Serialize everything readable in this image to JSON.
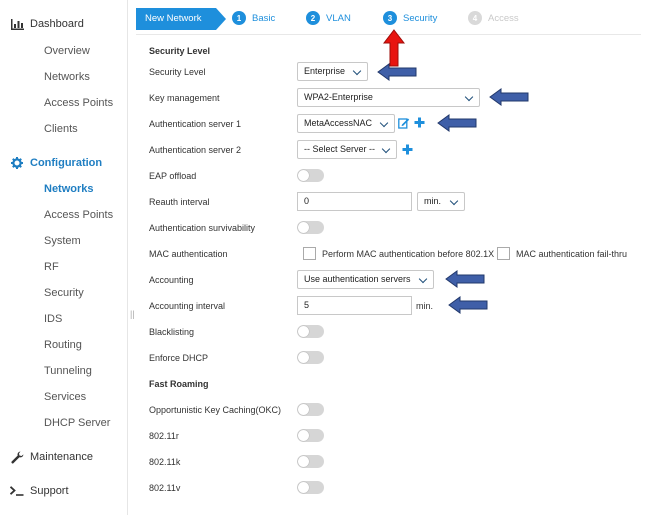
{
  "sidebar": {
    "dashboard": {
      "label": "Dashboard",
      "icon": "bar-chart-icon"
    },
    "dashboard_items": [
      "Overview",
      "Networks",
      "Access Points",
      "Clients"
    ],
    "configuration": {
      "label": "Configuration",
      "icon": "gear-icon"
    },
    "configuration_items": [
      "Networks",
      "Access Points",
      "System",
      "RF",
      "Security",
      "IDS",
      "Routing",
      "Tunneling",
      "Services",
      "DHCP Server"
    ],
    "active_item": "Networks",
    "maintenance": {
      "label": "Maintenance",
      "icon": "wrench-icon"
    },
    "support": {
      "label": "Support",
      "icon": "terminal-icon"
    }
  },
  "wizard": {
    "current": "New Network",
    "steps": [
      {
        "num": "1",
        "label": "Basic"
      },
      {
        "num": "2",
        "label": "VLAN"
      },
      {
        "num": "3",
        "label": "Security"
      },
      {
        "num": "4",
        "label": "Access"
      }
    ]
  },
  "form": {
    "section_security": "Security Level",
    "security_level": {
      "label": "Security Level",
      "value": "Enterprise"
    },
    "key_management": {
      "label": "Key management",
      "value": "WPA2-Enterprise"
    },
    "auth_server_1": {
      "label": "Authentication server 1",
      "value": "MetaAccessNAC"
    },
    "auth_server_2": {
      "label": "Authentication server 2",
      "value": "-- Select Server --"
    },
    "eap_offload": {
      "label": "EAP offload"
    },
    "reauth_interval": {
      "label": "Reauth interval",
      "value": "0",
      "unit": "min."
    },
    "auth_survivability": {
      "label": "Authentication survivability"
    },
    "mac_auth": {
      "label": "MAC authentication",
      "option1": "Perform MAC authentication before 802.1X",
      "option2": "MAC authentication fail-thru"
    },
    "accounting": {
      "label": "Accounting",
      "value": "Use authentication servers"
    },
    "accounting_interval": {
      "label": "Accounting interval",
      "value": "5",
      "unit": "min."
    },
    "blacklisting": {
      "label": "Blacklisting"
    },
    "enforce_dhcp": {
      "label": "Enforce DHCP"
    },
    "section_fast_roaming": "Fast Roaming",
    "okc": {
      "label": "Opportunistic Key Caching(OKC)"
    },
    "r80211r": {
      "label": "802.11r"
    },
    "r80211k": {
      "label": "802.11k"
    },
    "r80211v": {
      "label": "802.11v"
    }
  },
  "colors": {
    "accent": "#1e8fdc",
    "arrow_blue": "#3f5fa8",
    "arrow_red": "#e8140f"
  }
}
